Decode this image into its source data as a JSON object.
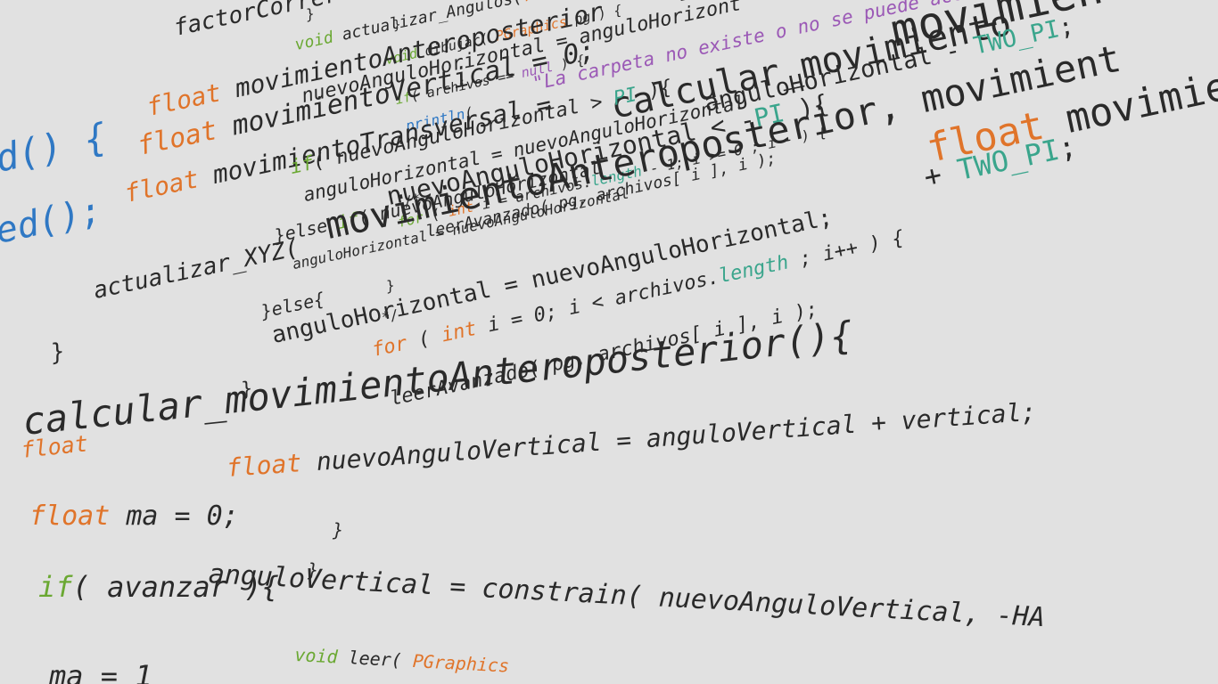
{
  "colors": {
    "background": "#e1e1e1",
    "text": "#2a2a2a",
    "keyword_type": "#e0742a",
    "keyword_control": "#6aa832",
    "constant": "#3aa58c",
    "string": "#9b59b6",
    "function_ref": "#2f78c4"
  },
  "fragments": [
    {
      "parts": [
        {
          "t": "voi",
          "c": "green"
        }
      ]
    },
    {
      "parts": [
        {
          "t": "factorCorrer = ( co",
          "c": "text"
        }
      ]
    },
    {
      "parts": [
        {
          "t": "}",
          "c": "text"
        }
      ]
    },
    {
      "parts": [
        {
          "t": "void ",
          "c": "green"
        },
        {
          "t": "actualizar_Angulos(",
          "c": "text"
        },
        {
          "t": "flo",
          "c": "orange"
        }
      ]
    },
    {
      "parts": [
        {
          "t": "}",
          "c": "text"
        }
      ]
    },
    {
      "parts": [
        {
          "t": "void ",
          "c": "green"
        },
        {
          "t": "dibujar( ",
          "c": "text"
        },
        {
          "t": "PGraphics",
          "c": "orange"
        },
        {
          "t": " pg ) {",
          "c": "text"
        }
      ]
    },
    {
      "parts": [
        {
          "t": "= calc",
          "c": "text"
        }
      ]
    },
    {
      "parts": [
        {
          "t": "float ",
          "c": "orange"
        },
        {
          "t": "movimientoAnteroposterior",
          "c": "text"
        }
      ]
    },
    {
      "parts": [
        {
          "t": "nuevoAnguloHorizontal = anguloHorizont",
          "c": "text"
        }
      ]
    },
    {
      "parts": [
        {
          "t": "\"La carpeta no existe o no se puede acceder\"",
          "c": "purple"
        },
        {
          "t": ");",
          "c": "text"
        }
      ]
    },
    {
      "parts": [
        {
          "t": "if",
          "c": "green"
        },
        {
          "t": "( archivos == ",
          "c": "text"
        },
        {
          "t": "null",
          "c": "purple"
        },
        {
          "t": " ) {",
          "c": "text"
        }
      ]
    },
    {
      "parts": [
        {
          "t": "float ",
          "c": "orange"
        },
        {
          "t": "movimientoVertical = 0;",
          "c": "text"
        }
      ]
    },
    {
      "parts": [
        {
          "t": "println",
          "c": "blue"
        },
        {
          "t": "(",
          "c": "text"
        }
      ]
    },
    {
      "parts": [
        {
          "t": "movimientoTran",
          "c": "text"
        }
      ]
    },
    {
      "parts": [
        {
          "t": "calcular_movimiento",
          "c": "text"
        }
      ]
    },
    {
      "parts": [
        {
          "t": "anguloHorizontal - ",
          "c": "text"
        },
        {
          "t": "TWO_PI",
          "c": "teal"
        },
        {
          "t": ";",
          "c": "text"
        }
      ]
    },
    {
      "parts": [
        {
          "t": "d() {",
          "c": "blue"
        }
      ]
    },
    {
      "parts": [
        {
          "t": "float ",
          "c": "orange"
        },
        {
          "t": "movimientoTransversal = ",
          "c": "text"
        }
      ]
    },
    {
      "parts": [
        {
          "t": "if",
          "c": "green"
        },
        {
          "t": "( nuevoAnguloHorizontal > ",
          "c": "text"
        },
        {
          "t": "PI",
          "c": "teal"
        },
        {
          "t": " ){",
          "c": "text"
        }
      ]
    },
    {
      "parts": [
        {
          "t": "anguloHorizontal = nuevoAnguloHorizontal",
          "c": "text"
        }
      ]
    },
    {
      "parts": [
        {
          "t": "for",
          "c": "green"
        },
        {
          "t": " ( ",
          "c": "text"
        },
        {
          "t": "int",
          "c": "orange"
        },
        {
          "t": " i = archivos.",
          "c": "text"
        },
        {
          "t": "length",
          "c": "teal"
        },
        {
          "t": " - 1; i >= 0 ; i-- ) {",
          "c": "text"
        }
      ]
    },
    {
      "parts": [
        {
          "t": "float ",
          "c": "orange"
        },
        {
          "t": "movimiento",
          "c": "text"
        }
      ]
    },
    {
      "parts": [
        {
          "t": "nuevoAnguloHorizontal < -",
          "c": "text"
        },
        {
          "t": "PI",
          "c": "teal"
        },
        {
          "t": " ){",
          "c": "text"
        }
      ]
    },
    {
      "parts": [
        {
          "t": "/*",
          "c": "text"
        }
      ]
    },
    {
      "parts": [
        {
          "t": "ed();",
          "c": "blue"
        }
      ]
    },
    {
      "parts": [
        {
          "t": "}else ",
          "c": "text"
        },
        {
          "t": "if",
          "c": "green"
        },
        {
          "t": "( nuevoAnguloHorizontal",
          "c": "text"
        }
      ]
    },
    {
      "parts": [
        {
          "t": "leerAvanzado( pg, archivos[ i ], i );",
          "c": "text"
        }
      ]
    },
    {
      "parts": [
        {
          "t": "+ ",
          "c": "text"
        },
        {
          "t": "TWO_PI",
          "c": "teal"
        },
        {
          "t": ";",
          "c": "text"
        }
      ]
    },
    {
      "parts": [
        {
          "t": "anguloHorizontal = nuevoAnguloHorizontal",
          "c": "text"
        }
      ]
    },
    {
      "parts": [
        {
          "t": "movimientoAnteroposterior, movimient",
          "c": "text"
        }
      ]
    },
    {
      "parts": [
        {
          "t": "actualizar_XYZ(",
          "c": "text"
        }
      ]
    },
    {
      "parts": [
        {
          "t": "}else{",
          "c": "text"
        }
      ]
    },
    {
      "parts": [
        {
          "t": "}",
          "c": "text"
        }
      ]
    },
    {
      "parts": [
        {
          "t": "*/",
          "c": "text"
        }
      ]
    },
    {
      "parts": [
        {
          "t": "anguloHorizontal = nuevoAnguloHorizontal;",
          "c": "text"
        }
      ]
    },
    {
      "parts": [
        {
          "t": "}",
          "c": "text"
        }
      ]
    },
    {
      "parts": [
        {
          "t": "for",
          "c": "orange"
        },
        {
          "t": " ( ",
          "c": "text"
        },
        {
          "t": "int",
          "c": "orange"
        },
        {
          "t": " i = 0; i < archivos.",
          "c": "text"
        },
        {
          "t": "length",
          "c": "teal"
        },
        {
          "t": " ; i++ ) {",
          "c": "text"
        }
      ]
    },
    {
      "parts": [
        {
          "t": "}",
          "c": "text"
        }
      ]
    },
    {
      "parts": [
        {
          "t": "leerAvanzado( pg, archivos[ i ], i );",
          "c": "text"
        }
      ]
    },
    {
      "parts": [
        {
          "t": "calcular_movimientoAnteroposterior(){",
          "c": "text"
        }
      ]
    },
    {
      "parts": [
        {
          "t": "float ",
          "c": "orange"
        }
      ]
    },
    {
      "parts": [
        {
          "t": "float ",
          "c": "orange"
        },
        {
          "t": "nuevoAnguloVertical = anguloVertical + vertical;",
          "c": "text"
        }
      ]
    },
    {
      "parts": [
        {
          "t": "float ",
          "c": "orange"
        },
        {
          "t": "ma = 0;",
          "c": "text"
        }
      ]
    },
    {
      "parts": [
        {
          "t": "}",
          "c": "text"
        }
      ]
    },
    {
      "parts": [
        {
          "t": "}",
          "c": "text"
        }
      ]
    },
    {
      "parts": [
        {
          "t": "anguloVertical = constrain( nuevoAnguloVertical, -HA",
          "c": "text"
        }
      ]
    },
    {
      "parts": [
        {
          "t": "if",
          "c": "green"
        },
        {
          "t": "( avanzar ){",
          "c": "text"
        }
      ]
    },
    {
      "parts": [
        {
          "t": "void ",
          "c": "green"
        },
        {
          "t": "leer( ",
          "c": "text"
        },
        {
          "t": "PGraphics",
          "c": "orange"
        }
      ]
    },
    {
      "parts": [
        {
          "t": "ma = 1",
          "c": "text"
        }
      ]
    }
  ]
}
